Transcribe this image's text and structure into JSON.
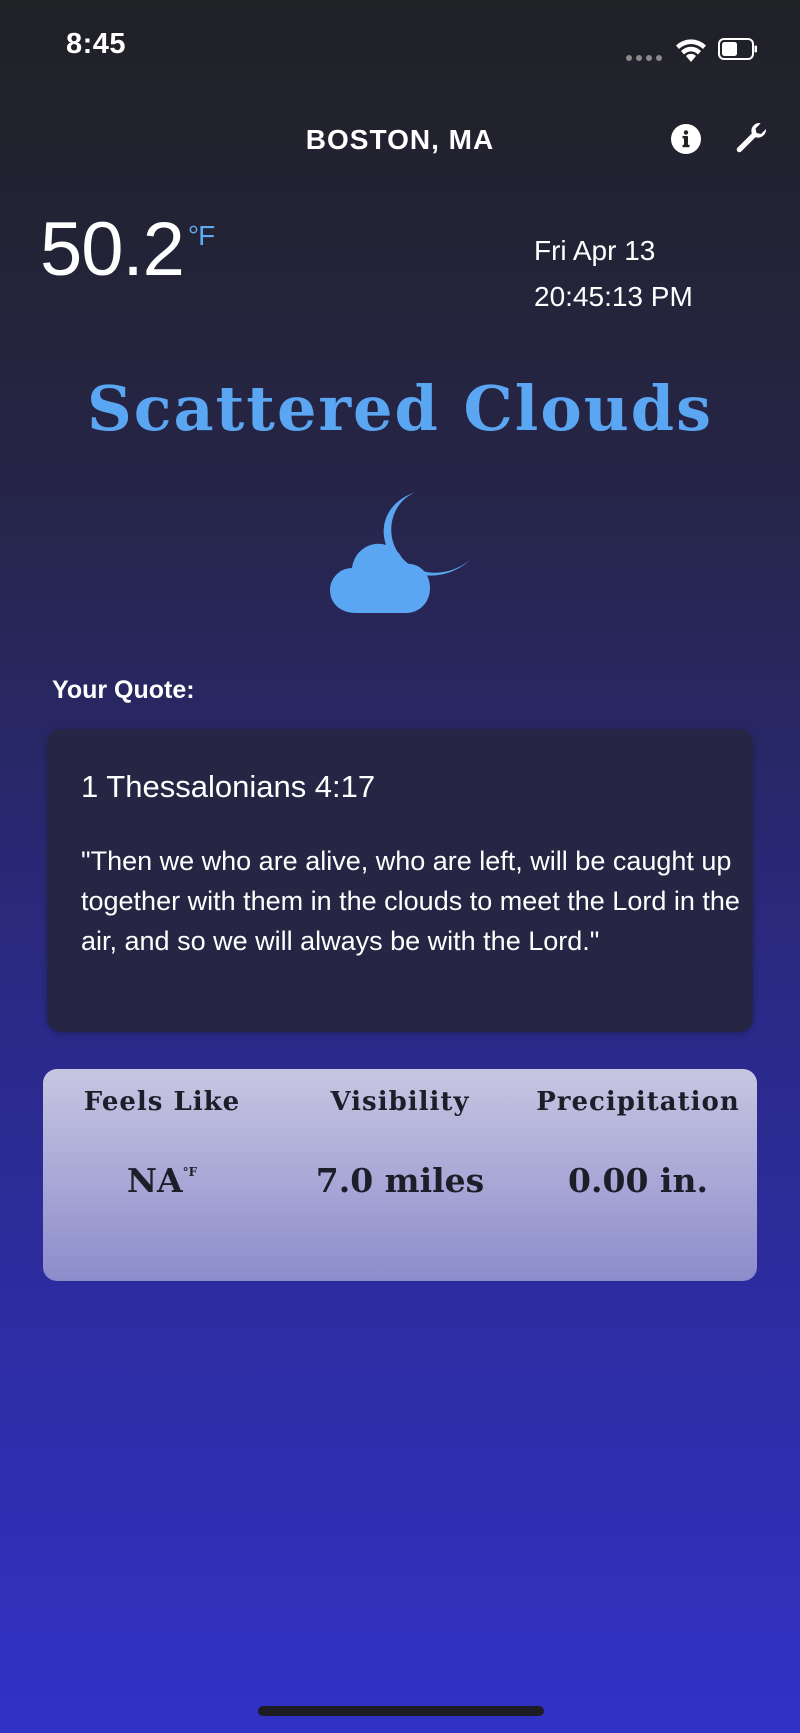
{
  "status_bar": {
    "time": "8:45"
  },
  "header": {
    "city": "BOSTON, MA",
    "info_icon": "info-icon",
    "settings_icon": "wrench-icon"
  },
  "weather": {
    "temperature": "50.2",
    "unit": "°F",
    "date": "Fri Apr 13",
    "time": "20:45:13 PM",
    "condition": "Scattered Clouds",
    "condition_icon": "cloud-moon-icon",
    "accent_color": "#5aa6f2"
  },
  "quote": {
    "label": "Your Quote:",
    "reference": "1 Thessalonians 4:17",
    "text": "\"Then we who are alive, who are left, will be caught up together with them in the clouds to meet the Lord in the air, and so we will always be with the Lord.\""
  },
  "stats": {
    "feels_like": {
      "label": "Feels Like",
      "value": "NA",
      "unit": "°F"
    },
    "visibility": {
      "label": "Visibility",
      "value": "7.0 miles"
    },
    "precipitation": {
      "label": "Precipitation",
      "value": "0.00 in."
    }
  }
}
